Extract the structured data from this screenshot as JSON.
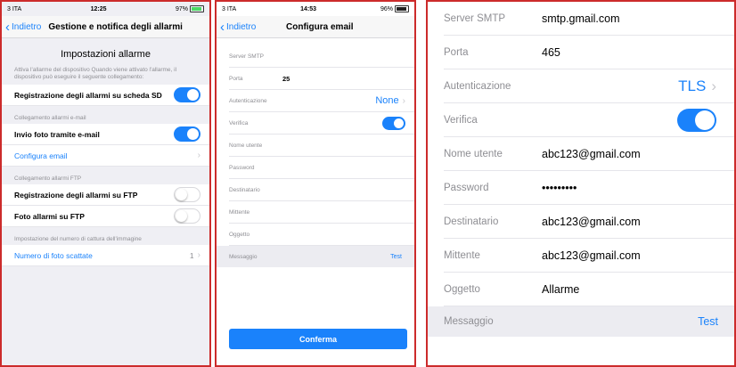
{
  "panel1": {
    "status": {
      "carrier": "3 ITA",
      "time": "12:25",
      "battery": "97%"
    },
    "nav": {
      "back": "Indietro",
      "title": "Gestione e notifica degli allarmi"
    },
    "section_title": "Impostazioni allarme",
    "section_desc": "Attiva l'allarme del dispositivo Quando viene attivato l'allarme, il dispositivo può eseguire il seguente collegamento:",
    "sd_row": "Registrazione degli allarmi su scheda SD",
    "email_header": "Collegamento allarmi e-mail",
    "email_photo": "Invio foto tramite e-mail",
    "config_email": "Configura email",
    "ftp_header": "Collegamento allarmi FTP",
    "ftp_reg": "Registrazione degli allarmi su FTP",
    "ftp_photo": "Foto allarmi su FTP",
    "capture_header": "Impostazione del numero di cattura dell'immagine",
    "photo_count_label": "Numero di foto scattate",
    "photo_count_value": "1"
  },
  "panel2": {
    "status": {
      "carrier": "3 ITA",
      "time": "14:53",
      "battery": "96%"
    },
    "nav": {
      "back": "Indietro",
      "title": "Configura email"
    },
    "fields": {
      "smtp": "Server SMTP",
      "port": "Porta",
      "port_value": "25",
      "auth": "Autenticazione",
      "auth_value": "None",
      "verify": "Verifica",
      "user": "Nome utente",
      "password": "Password",
      "recipient": "Destinatario",
      "sender": "Mittente",
      "subject": "Oggetto",
      "message": "Messaggio",
      "test": "Test"
    },
    "confirm": "Conferma"
  },
  "panel3": {
    "smtp": "Server SMTP",
    "smtp_value": "smtp.gmail.com",
    "port": "Porta",
    "port_value": "465",
    "auth": "Autenticazione",
    "auth_value": "TLS",
    "verify": "Verifica",
    "user": "Nome utente",
    "user_value": "abc123@gmail.com",
    "password": "Password",
    "password_value": "•••••••••",
    "recipient": "Destinatario",
    "recipient_value": "abc123@gmail.com",
    "sender": "Mittente",
    "sender_value": "abc123@gmail.com",
    "subject": "Oggetto",
    "subject_value": "Allarme",
    "message": "Messaggio",
    "test": "Test"
  },
  "colors": {
    "accent": "#1a82fb",
    "border": "#cc2b2b"
  }
}
